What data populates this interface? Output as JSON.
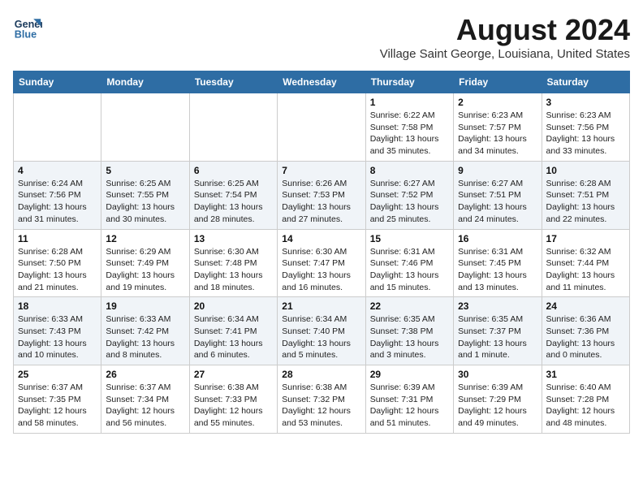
{
  "logo": {
    "line1": "General",
    "line2": "Blue"
  },
  "title": "August 2024",
  "location": "Village Saint George, Louisiana, United States",
  "days_of_week": [
    "Sunday",
    "Monday",
    "Tuesday",
    "Wednesday",
    "Thursday",
    "Friday",
    "Saturday"
  ],
  "weeks": [
    [
      {
        "day": "",
        "detail": ""
      },
      {
        "day": "",
        "detail": ""
      },
      {
        "day": "",
        "detail": ""
      },
      {
        "day": "",
        "detail": ""
      },
      {
        "day": "1",
        "detail": "Sunrise: 6:22 AM\nSunset: 7:58 PM\nDaylight: 13 hours\nand 35 minutes."
      },
      {
        "day": "2",
        "detail": "Sunrise: 6:23 AM\nSunset: 7:57 PM\nDaylight: 13 hours\nand 34 minutes."
      },
      {
        "day": "3",
        "detail": "Sunrise: 6:23 AM\nSunset: 7:56 PM\nDaylight: 13 hours\nand 33 minutes."
      }
    ],
    [
      {
        "day": "4",
        "detail": "Sunrise: 6:24 AM\nSunset: 7:56 PM\nDaylight: 13 hours\nand 31 minutes."
      },
      {
        "day": "5",
        "detail": "Sunrise: 6:25 AM\nSunset: 7:55 PM\nDaylight: 13 hours\nand 30 minutes."
      },
      {
        "day": "6",
        "detail": "Sunrise: 6:25 AM\nSunset: 7:54 PM\nDaylight: 13 hours\nand 28 minutes."
      },
      {
        "day": "7",
        "detail": "Sunrise: 6:26 AM\nSunset: 7:53 PM\nDaylight: 13 hours\nand 27 minutes."
      },
      {
        "day": "8",
        "detail": "Sunrise: 6:27 AM\nSunset: 7:52 PM\nDaylight: 13 hours\nand 25 minutes."
      },
      {
        "day": "9",
        "detail": "Sunrise: 6:27 AM\nSunset: 7:51 PM\nDaylight: 13 hours\nand 24 minutes."
      },
      {
        "day": "10",
        "detail": "Sunrise: 6:28 AM\nSunset: 7:51 PM\nDaylight: 13 hours\nand 22 minutes."
      }
    ],
    [
      {
        "day": "11",
        "detail": "Sunrise: 6:28 AM\nSunset: 7:50 PM\nDaylight: 13 hours\nand 21 minutes."
      },
      {
        "day": "12",
        "detail": "Sunrise: 6:29 AM\nSunset: 7:49 PM\nDaylight: 13 hours\nand 19 minutes."
      },
      {
        "day": "13",
        "detail": "Sunrise: 6:30 AM\nSunset: 7:48 PM\nDaylight: 13 hours\nand 18 minutes."
      },
      {
        "day": "14",
        "detail": "Sunrise: 6:30 AM\nSunset: 7:47 PM\nDaylight: 13 hours\nand 16 minutes."
      },
      {
        "day": "15",
        "detail": "Sunrise: 6:31 AM\nSunset: 7:46 PM\nDaylight: 13 hours\nand 15 minutes."
      },
      {
        "day": "16",
        "detail": "Sunrise: 6:31 AM\nSunset: 7:45 PM\nDaylight: 13 hours\nand 13 minutes."
      },
      {
        "day": "17",
        "detail": "Sunrise: 6:32 AM\nSunset: 7:44 PM\nDaylight: 13 hours\nand 11 minutes."
      }
    ],
    [
      {
        "day": "18",
        "detail": "Sunrise: 6:33 AM\nSunset: 7:43 PM\nDaylight: 13 hours\nand 10 minutes."
      },
      {
        "day": "19",
        "detail": "Sunrise: 6:33 AM\nSunset: 7:42 PM\nDaylight: 13 hours\nand 8 minutes."
      },
      {
        "day": "20",
        "detail": "Sunrise: 6:34 AM\nSunset: 7:41 PM\nDaylight: 13 hours\nand 6 minutes."
      },
      {
        "day": "21",
        "detail": "Sunrise: 6:34 AM\nSunset: 7:40 PM\nDaylight: 13 hours\nand 5 minutes."
      },
      {
        "day": "22",
        "detail": "Sunrise: 6:35 AM\nSunset: 7:38 PM\nDaylight: 13 hours\nand 3 minutes."
      },
      {
        "day": "23",
        "detail": "Sunrise: 6:35 AM\nSunset: 7:37 PM\nDaylight: 13 hours\nand 1 minute."
      },
      {
        "day": "24",
        "detail": "Sunrise: 6:36 AM\nSunset: 7:36 PM\nDaylight: 13 hours\nand 0 minutes."
      }
    ],
    [
      {
        "day": "25",
        "detail": "Sunrise: 6:37 AM\nSunset: 7:35 PM\nDaylight: 12 hours\nand 58 minutes."
      },
      {
        "day": "26",
        "detail": "Sunrise: 6:37 AM\nSunset: 7:34 PM\nDaylight: 12 hours\nand 56 minutes."
      },
      {
        "day": "27",
        "detail": "Sunrise: 6:38 AM\nSunset: 7:33 PM\nDaylight: 12 hours\nand 55 minutes."
      },
      {
        "day": "28",
        "detail": "Sunrise: 6:38 AM\nSunset: 7:32 PM\nDaylight: 12 hours\nand 53 minutes."
      },
      {
        "day": "29",
        "detail": "Sunrise: 6:39 AM\nSunset: 7:31 PM\nDaylight: 12 hours\nand 51 minutes."
      },
      {
        "day": "30",
        "detail": "Sunrise: 6:39 AM\nSunset: 7:29 PM\nDaylight: 12 hours\nand 49 minutes."
      },
      {
        "day": "31",
        "detail": "Sunrise: 6:40 AM\nSunset: 7:28 PM\nDaylight: 12 hours\nand 48 minutes."
      }
    ]
  ]
}
